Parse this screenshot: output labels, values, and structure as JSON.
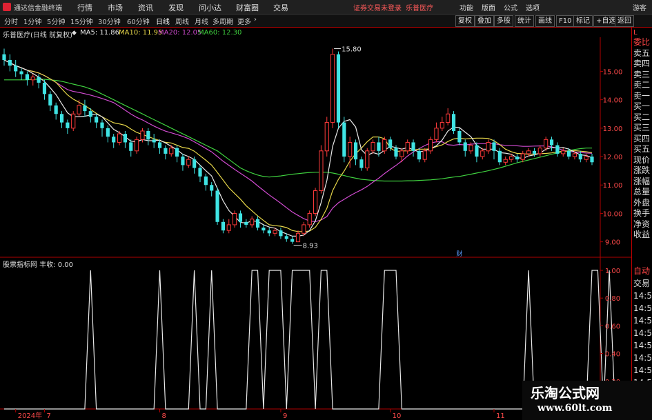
{
  "app": {
    "title": "通达信金融终端"
  },
  "menu": [
    "行情",
    "市场",
    "资讯",
    "发现",
    "问小达",
    "财富圈",
    "交易"
  ],
  "alert": {
    "text": "证券交易未登录",
    "stock": "乐普医疗"
  },
  "menu_right": [
    "功能",
    "版面",
    "公式",
    "选项"
  ],
  "guest": "游客",
  "periods": [
    "分时",
    "1分钟",
    "5分钟",
    "15分钟",
    "30分钟",
    "60分钟",
    "日线",
    "周线",
    "月线",
    "多周期",
    "更多"
  ],
  "active_period": "日线",
  "toolbar": [
    "复权",
    "叠加",
    "多股",
    "统计",
    "画线",
    "F10",
    "标记",
    "+自选",
    "返回"
  ],
  "main_title": "乐普医疗(日线 前复权)",
  "ma": [
    {
      "label": "MA5: 11.86",
      "color": "#e8e8e8"
    },
    {
      "label": "MA10: 11.95",
      "color": "#e8d84a"
    },
    {
      "label": "MA20: 12.05",
      "color": "#d04bd0"
    },
    {
      "label": "MA60: 12.30",
      "color": "#3fd13f"
    }
  ],
  "price_axis": [
    "15.00",
    "14.00",
    "13.00",
    "12.00",
    "11.00",
    "10.00",
    "9.00"
  ],
  "annotations": {
    "high": "15.80",
    "low": "8.93",
    "fin": "财"
  },
  "indicator": {
    "title": "股票指标网 丰收: 0.00",
    "axis": [
      "1.00",
      "0.80",
      "0.60",
      "0.40",
      "0.20"
    ]
  },
  "time_axis": [
    "2024年",
    "7",
    "8",
    "9",
    "10",
    "11",
    "12"
  ],
  "right_panel": {
    "header": "L",
    "top": [
      "委比",
      "卖五",
      "卖四",
      "卖三",
      "卖二",
      "卖一",
      "买一",
      "买二",
      "买三",
      "买四",
      "买五",
      "现价",
      "涨跌",
      "涨幅",
      "总量",
      "外盘",
      "换手",
      "净资",
      "收益"
    ],
    "bottom": [
      "自动",
      "交易",
      "14:5",
      "14:5",
      "14:5",
      "14:5",
      "14:5",
      "14:5",
      "14:5",
      "14:5",
      "14:5",
      "14:5"
    ]
  },
  "watermark": {
    "line1": "乐淘公式网",
    "line2": "www.60lt.com"
  },
  "colors": {
    "up": "#ff3b3b",
    "down": "#3fe3e3",
    "border": "#b00000"
  },
  "chart_data": {
    "type": "candlestick",
    "ylim": [
      8.7,
      16.2
    ],
    "candles": [
      [
        15.6,
        15.4,
        15.8,
        15.2
      ],
      [
        15.4,
        15.2,
        15.6,
        15.0
      ],
      [
        15.2,
        15.0,
        15.4,
        14.8
      ],
      [
        15.0,
        14.9,
        15.1,
        14.7
      ],
      [
        14.9,
        14.7,
        15.0,
        14.5
      ],
      [
        14.7,
        14.8,
        14.9,
        14.5
      ],
      [
        14.8,
        14.6,
        14.9,
        14.4
      ],
      [
        14.6,
        14.2,
        14.7,
        14.0
      ],
      [
        14.2,
        13.8,
        14.3,
        13.6
      ],
      [
        13.8,
        13.5,
        13.9,
        13.3
      ],
      [
        13.5,
        13.2,
        13.6,
        13.0
      ],
      [
        13.2,
        13.0,
        13.3,
        12.8
      ],
      [
        13.0,
        13.5,
        13.6,
        12.9
      ],
      [
        13.5,
        13.8,
        14.0,
        13.4
      ],
      [
        13.8,
        13.6,
        14.0,
        13.4
      ],
      [
        13.6,
        13.4,
        13.7,
        13.2
      ],
      [
        13.4,
        13.2,
        13.5,
        13.0
      ],
      [
        13.2,
        13.0,
        13.3,
        12.7
      ],
      [
        13.0,
        12.7,
        13.1,
        12.5
      ],
      [
        12.7,
        12.5,
        12.8,
        12.3
      ],
      [
        12.5,
        12.8,
        12.9,
        12.4
      ],
      [
        12.8,
        12.5,
        12.9,
        12.3
      ],
      [
        12.5,
        12.2,
        12.6,
        12.0
      ],
      [
        12.2,
        12.6,
        12.7,
        12.1
      ],
      [
        12.6,
        12.9,
        13.0,
        12.5
      ],
      [
        12.9,
        12.6,
        13.0,
        12.4
      ],
      [
        12.6,
        12.5,
        12.8,
        12.3
      ],
      [
        12.5,
        12.3,
        12.6,
        12.1
      ],
      [
        12.3,
        12.1,
        12.4,
        11.9
      ],
      [
        12.1,
        12.3,
        12.4,
        12.0
      ],
      [
        12.3,
        12.0,
        12.4,
        11.8
      ],
      [
        12.0,
        11.7,
        12.1,
        11.5
      ],
      [
        11.7,
        11.9,
        12.0,
        11.6
      ],
      [
        11.9,
        11.6,
        12.0,
        11.4
      ],
      [
        11.6,
        11.3,
        11.7,
        11.1
      ],
      [
        11.3,
        11.0,
        11.4,
        10.8
      ],
      [
        11.0,
        10.8,
        11.1,
        10.6
      ],
      [
        10.8,
        9.7,
        10.9,
        9.6
      ],
      [
        9.7,
        9.4,
        9.8,
        9.3
      ],
      [
        9.4,
        9.6,
        9.8,
        9.3
      ],
      [
        9.6,
        10.0,
        10.1,
        9.5
      ],
      [
        10.0,
        9.7,
        10.1,
        9.5
      ],
      [
        9.7,
        9.6,
        9.8,
        9.5
      ],
      [
        9.6,
        9.8,
        9.9,
        9.5
      ],
      [
        9.8,
        9.5,
        9.9,
        9.4
      ],
      [
        9.5,
        9.4,
        9.6,
        9.3
      ],
      [
        9.4,
        9.3,
        9.5,
        9.2
      ],
      [
        9.3,
        9.4,
        9.5,
        9.2
      ],
      [
        9.4,
        9.2,
        9.5,
        9.1
      ],
      [
        9.2,
        9.1,
        9.3,
        9.0
      ],
      [
        9.1,
        9.0,
        9.2,
        8.93
      ],
      [
        9.0,
        9.3,
        9.4,
        9.0
      ],
      [
        9.3,
        9.6,
        9.7,
        9.2
      ],
      [
        9.6,
        10.0,
        10.1,
        9.5
      ],
      [
        10.0,
        10.8,
        10.9,
        9.9
      ],
      [
        10.8,
        12.2,
        12.4,
        10.7
      ],
      [
        12.2,
        13.2,
        13.4,
        12.0
      ],
      [
        13.2,
        15.6,
        15.8,
        13.0
      ],
      [
        15.6,
        13.2,
        15.7,
        13.0
      ],
      [
        13.2,
        12.0,
        13.4,
        11.8
      ],
      [
        12.0,
        12.5,
        12.7,
        11.6
      ],
      [
        12.5,
        11.9,
        12.6,
        11.7
      ],
      [
        11.9,
        11.6,
        12.0,
        11.5
      ],
      [
        11.6,
        12.2,
        12.3,
        11.5
      ],
      [
        12.2,
        12.5,
        12.6,
        12.1
      ],
      [
        12.5,
        12.2,
        12.7,
        12.0
      ],
      [
        12.2,
        12.6,
        12.7,
        12.1
      ],
      [
        12.6,
        12.3,
        12.7,
        12.2
      ],
      [
        12.3,
        12.0,
        12.4,
        11.9
      ],
      [
        12.0,
        12.2,
        12.3,
        11.8
      ],
      [
        12.2,
        12.5,
        12.6,
        12.1
      ],
      [
        12.5,
        12.2,
        12.6,
        12.0
      ],
      [
        12.2,
        11.9,
        12.3,
        11.8
      ],
      [
        11.9,
        12.2,
        12.3,
        11.8
      ],
      [
        12.2,
        12.6,
        12.7,
        12.1
      ],
      [
        12.6,
        13.0,
        13.2,
        12.5
      ],
      [
        13.0,
        13.2,
        13.4,
        12.9
      ],
      [
        13.2,
        13.5,
        13.7,
        13.1
      ],
      [
        13.5,
        12.9,
        13.6,
        12.8
      ],
      [
        12.9,
        12.5,
        13.0,
        12.4
      ],
      [
        12.5,
        12.2,
        12.6,
        12.0
      ],
      [
        12.2,
        12.4,
        12.5,
        12.1
      ],
      [
        12.4,
        12.0,
        12.5,
        11.8
      ],
      [
        12.0,
        12.2,
        12.3,
        11.9
      ],
      [
        12.2,
        12.5,
        12.6,
        12.1
      ],
      [
        12.5,
        12.2,
        12.6,
        11.9
      ],
      [
        12.2,
        11.8,
        12.3,
        11.7
      ],
      [
        11.8,
        11.9,
        12.0,
        11.7
      ],
      [
        11.9,
        12.0,
        12.1,
        11.8
      ],
      [
        12.0,
        11.9,
        12.1,
        11.8
      ],
      [
        11.9,
        12.1,
        12.2,
        11.8
      ],
      [
        12.1,
        12.2,
        12.3,
        12.0
      ],
      [
        12.2,
        12.1,
        12.3,
        12.0
      ],
      [
        12.1,
        12.3,
        12.4,
        12.0
      ],
      [
        12.3,
        12.6,
        12.7,
        12.2
      ],
      [
        12.6,
        12.4,
        12.7,
        12.2
      ],
      [
        12.4,
        12.1,
        12.5,
        12.0
      ],
      [
        12.1,
        12.2,
        12.3,
        12.0
      ],
      [
        12.2,
        12.0,
        12.3,
        11.9
      ],
      [
        12.0,
        12.1,
        12.2,
        11.9
      ],
      [
        12.1,
        11.9,
        12.2,
        11.8
      ],
      [
        11.9,
        12.0,
        12.1,
        11.8
      ],
      [
        12.0,
        11.8,
        12.1,
        11.7
      ]
    ],
    "ma60": [
      14.7,
      14.7,
      14.7,
      14.7,
      14.7,
      14.72,
      14.72,
      14.72,
      14.7,
      14.68,
      14.65,
      14.6,
      14.55,
      14.5,
      14.45,
      14.38,
      14.3,
      14.2,
      14.1,
      14.0,
      13.9,
      13.8,
      13.7,
      13.6,
      13.5,
      13.4,
      13.3,
      13.2,
      13.1,
      13.0,
      12.9,
      12.8,
      12.7,
      12.6,
      12.5,
      12.4,
      12.3,
      12.2,
      12.05,
      11.9,
      11.75,
      11.6,
      11.5,
      11.42,
      11.35,
      11.3,
      11.28,
      11.3,
      11.32,
      11.35,
      11.38,
      11.4,
      11.42,
      11.44,
      11.45,
      11.45,
      11.45,
      11.42,
      11.38,
      11.33,
      11.28,
      11.24,
      11.2,
      11.18,
      11.16,
      11.15,
      11.14,
      11.14,
      11.14,
      11.14,
      11.15,
      11.15,
      11.16,
      11.17,
      11.18,
      11.2,
      11.22,
      11.25,
      11.28,
      11.3,
      11.34,
      11.38,
      11.42,
      11.46,
      11.5,
      11.55,
      11.6,
      11.66,
      11.72,
      11.78,
      11.83,
      11.88,
      11.93,
      11.98,
      12.03,
      12.08,
      12.13,
      12.17,
      12.21,
      12.25,
      12.28,
      12.3,
      12.3
    ],
    "signal": [
      0,
      0,
      0,
      0,
      0,
      0,
      0,
      0,
      0,
      0,
      0,
      0,
      0,
      0,
      0,
      1,
      0,
      0,
      0,
      0,
      0,
      0,
      0,
      0,
      0,
      0,
      0,
      1,
      0,
      0,
      0,
      0,
      0,
      1,
      0,
      0,
      1,
      0,
      0,
      0,
      0,
      0,
      0,
      1,
      1,
      0,
      1,
      1,
      1,
      0,
      1,
      1,
      1,
      1,
      0,
      1,
      1,
      0,
      0,
      0,
      0,
      0,
      0,
      0,
      0,
      0,
      1,
      1,
      1,
      0,
      0,
      0,
      0,
      0,
      0,
      0,
      0,
      0,
      0,
      0,
      0,
      0,
      0,
      0,
      0,
      0,
      0,
      0,
      0,
      0,
      0,
      1,
      0,
      0,
      0,
      0,
      0,
      0,
      0,
      0,
      0,
      0,
      1,
      1,
      0,
      1,
      0
    ],
    "time_ticks": [
      [
        "2024年",
        2
      ],
      [
        "7",
        7
      ],
      [
        "8",
        27
      ],
      [
        "9",
        48
      ],
      [
        "10",
        67
      ],
      [
        "11",
        85
      ],
      [
        "12",
        104
      ]
    ],
    "markers": {
      "high_index": 57,
      "low_index": 50,
      "fin_index": 79
    }
  }
}
